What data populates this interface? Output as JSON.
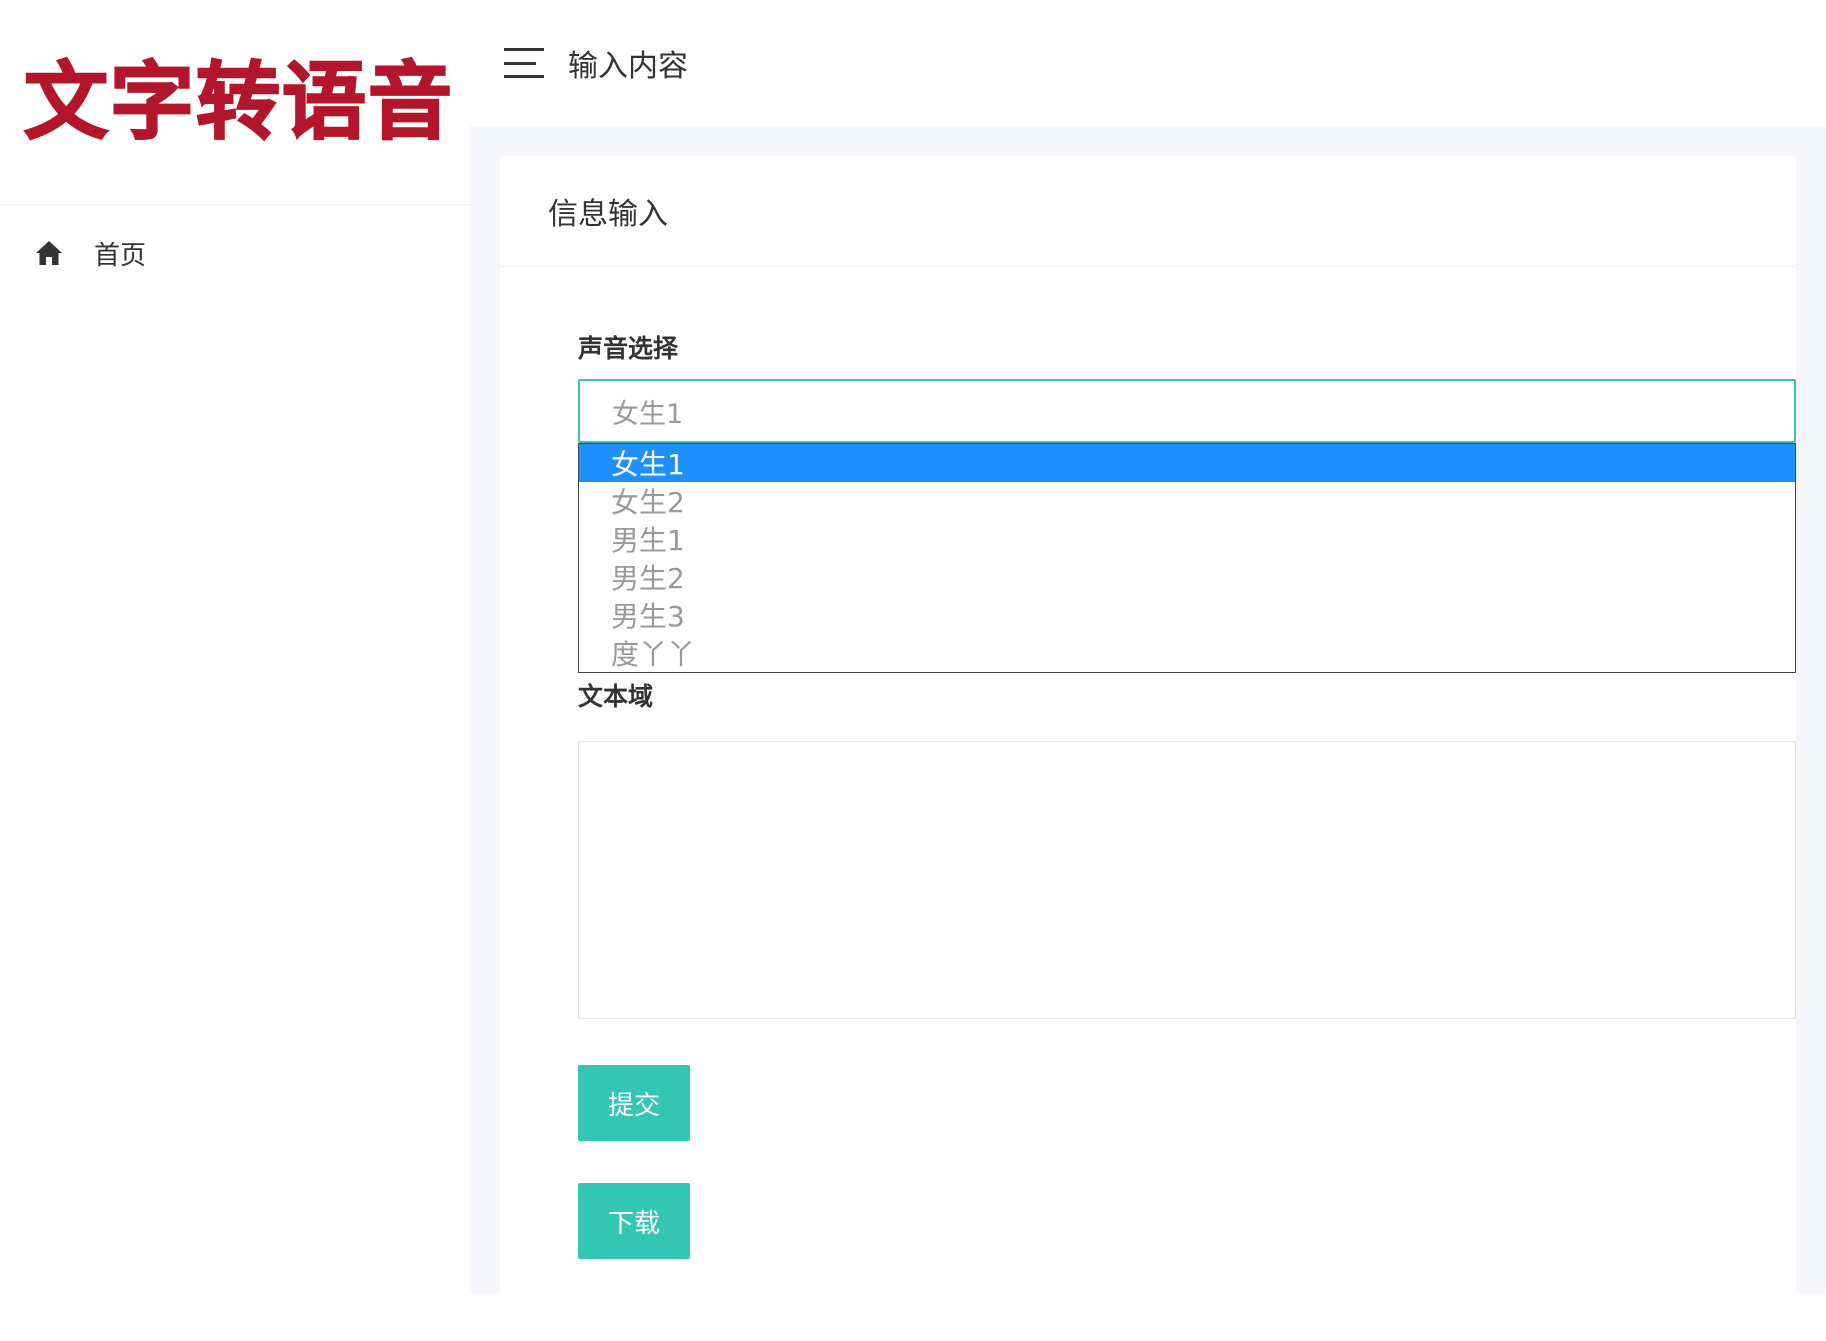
{
  "sidebar": {
    "logo": "文字转语音",
    "items": [
      {
        "icon": "home-icon",
        "label": "首页"
      }
    ]
  },
  "topbar": {
    "icon": "hamburger-menu-icon",
    "title": "输入内容"
  },
  "card": {
    "title": "信息输入"
  },
  "form": {
    "voice_label": "声音选择",
    "voice_selected": "女生1",
    "voice_options": [
      "女生1",
      "女生2",
      "男生1",
      "男生2",
      "男生3",
      "度丫丫"
    ],
    "voice_highlighted_index": 0,
    "text_label": "文本域",
    "text_value": "",
    "submit_label": "提交",
    "download_label": "下载"
  },
  "colors": {
    "logo": "#b3152b",
    "accent": "#33c6b3",
    "select_border": "#3cc3b0",
    "option_highlight": "#1e90ff",
    "main_bg": "#f5f7fa"
  }
}
